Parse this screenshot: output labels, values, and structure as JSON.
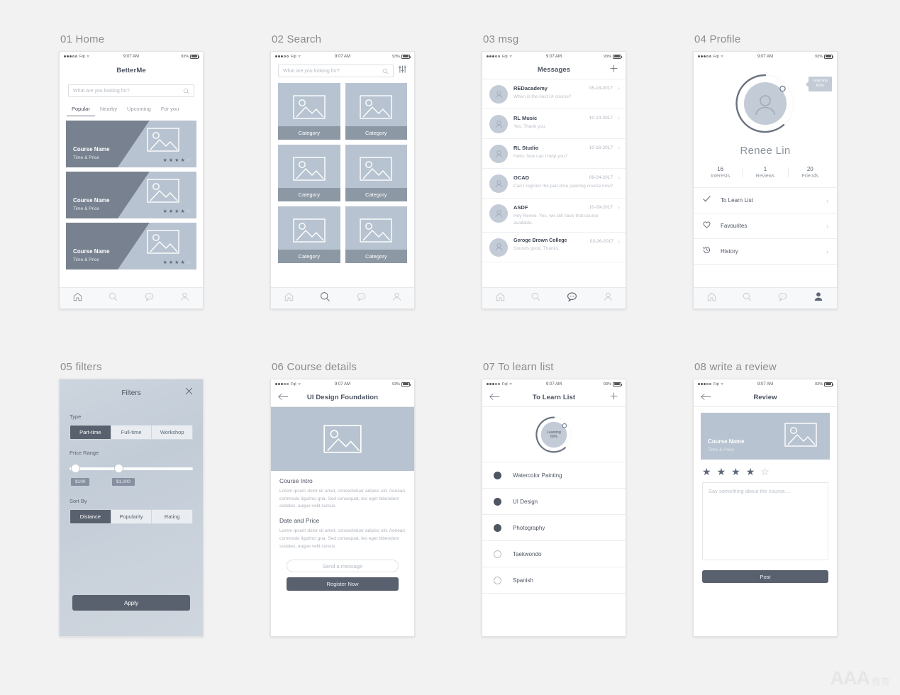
{
  "meta": {
    "watermark_main": "AAA",
    "watermark_sub": "教育"
  },
  "status_bar": {
    "carrier": "Fql",
    "time": "9:07 AM",
    "battery": "93%"
  },
  "screens": [
    {
      "caption": "01 Home",
      "title": "BetterMe",
      "search_placeholder": "What are you looking for?",
      "tabs": [
        "Popular",
        "Nearby",
        "Upcoming",
        "For you"
      ],
      "active_tab": "Popular",
      "cards": [
        {
          "name": "Course Name",
          "sub": "Time & Price",
          "rating": 4
        },
        {
          "name": "Course Name",
          "sub": "Time & Price",
          "rating": 4
        },
        {
          "name": "Course Name",
          "sub": "Time & Price",
          "rating": 4
        }
      ]
    },
    {
      "caption": "02 Search",
      "search_placeholder": "What are you looking for?",
      "categories": [
        "Category",
        "Category",
        "Category",
        "Category",
        "Category",
        "Category"
      ]
    },
    {
      "caption": "03 msg",
      "title": "Messages",
      "add_label": "+",
      "messages": [
        {
          "name": "REDacademy",
          "date": "05-18-2017",
          "preview": "When is the next UI course?"
        },
        {
          "name": "RL Music",
          "date": "10-14-2017",
          "preview": "Yes. Thank you."
        },
        {
          "name": "RL Studio",
          "date": "10-16-2017",
          "preview": "Hello, how can I help you?"
        },
        {
          "name": "OCAD",
          "date": "09-24-2017",
          "preview": "Can I register the part-time painting course now?"
        },
        {
          "name": "ASDF",
          "date": "10-09-2017",
          "preview": "Hey Renee. Yes, we still have that course available."
        },
        {
          "name": "Geroge Brown College",
          "date": "03-26-2017",
          "preview": "Sounds good. Thanks."
        }
      ]
    },
    {
      "caption": "04 Profile",
      "badge_line1": "Learning",
      "badge_line2": "60%",
      "user_name": "Renee Lin",
      "stats": [
        {
          "num": "16",
          "label": "Interests"
        },
        {
          "num": "1",
          "label": "Reviews"
        },
        {
          "num": "20",
          "label": "Friends"
        }
      ],
      "list": [
        {
          "icon": "check-icon",
          "label": "To Learn List"
        },
        {
          "icon": "heart-icon",
          "label": "Favourites"
        },
        {
          "icon": "history-icon",
          "label": "History"
        }
      ]
    },
    {
      "caption": "05 filters",
      "title": "Filters",
      "type_label": "Type",
      "type_options": [
        "Part-time",
        "Full-time",
        "Workshop"
      ],
      "type_active": "Part-time",
      "price_label": "Price Range",
      "price_min": "$100",
      "price_max": "$1,000",
      "sort_label": "Sort By",
      "sort_options": [
        "Distance",
        "Popularity",
        "Rating"
      ],
      "sort_active": "Distance",
      "apply_label": "Apply"
    },
    {
      "caption": "06 Course details",
      "title": "UI Design Foundation",
      "sections": [
        {
          "heading": "Course Intro",
          "body": "Lorem ipsum dolor sit amet, consectetuer adipisc elit. Aenean commodo ligutinci gna. Sed consequat, leo eget bibendum sodales, augue velit cursus."
        },
        {
          "heading": "Date and Price",
          "body": "Lorem ipsum dolor sit amet, consectetuer adipisc elit. Aenean commodo ligutinci gna. Sed consequat, leo eget bibendum sodales, augue velit cursus."
        }
      ],
      "message_btn": "Send a message",
      "register_btn": "Register Now"
    },
    {
      "caption": "07 To learn list",
      "title": "To Learn List",
      "add_label": "+",
      "badge_line1": "Learning",
      "badge_line2": "60%",
      "items": [
        {
          "label": "Watercolor Painting",
          "done": true
        },
        {
          "label": "UI Design",
          "done": true
        },
        {
          "label": "Photography",
          "done": true
        },
        {
          "label": "Taekwondo",
          "done": false
        },
        {
          "label": "Spanish",
          "done": false
        }
      ]
    },
    {
      "caption": "08 write a review",
      "title": "Review",
      "card": {
        "name": "Course Name",
        "sub": "Time & Price"
      },
      "rating": 4,
      "textarea_placeholder": "Say something about the course....",
      "post_label": "Post"
    }
  ],
  "colors": {
    "canvas": "#f2f2f2",
    "card_dark": "#77818f",
    "card_light": "#b7c3d0",
    "accent_dark": "#59616f",
    "text_dark": "#4b5260",
    "text_muted": "#aeb4bc"
  },
  "tabbar_icons": [
    "home-icon",
    "search-icon",
    "chat-icon",
    "person-icon"
  ]
}
